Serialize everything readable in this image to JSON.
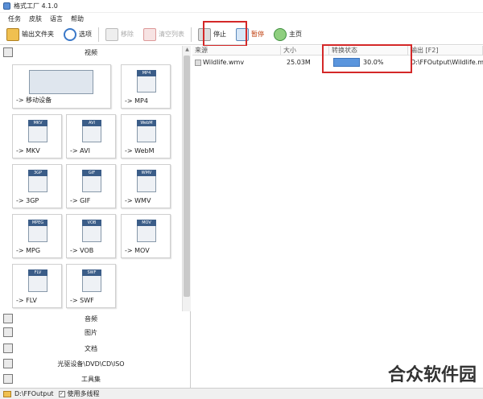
{
  "window": {
    "title": "格式工厂 4.1.0"
  },
  "menu": [
    "任务",
    "皮肤",
    "语言",
    "帮助"
  ],
  "toolbar": {
    "output_folder": "输出文件夹",
    "options": "选项",
    "remove": "移除",
    "clear_list": "清空列表",
    "stop": "停止",
    "pause": "暂停",
    "home": "主页"
  },
  "categories": {
    "video": "视频",
    "audio": "音频",
    "picture": "图片",
    "document": "文档",
    "optical": "光驱设备\\DVD\\CD\\ISO",
    "tools": "工具集"
  },
  "formats": [
    {
      "label": "-> 移动设备",
      "tag": ""
    },
    {
      "label": "-> MP4",
      "tag": "MP4"
    },
    {
      "label": "-> MKV",
      "tag": "MKV"
    },
    {
      "label": "-> AVI",
      "tag": "AVI"
    },
    {
      "label": "-> WebM",
      "tag": "WebM"
    },
    {
      "label": "-> 3GP",
      "tag": "3GP"
    },
    {
      "label": "-> GIF",
      "tag": "GIF"
    },
    {
      "label": "-> WMV",
      "tag": "WMV"
    },
    {
      "label": "-> MPG",
      "tag": "MPEG"
    },
    {
      "label": "-> VOB",
      "tag": "VOB"
    },
    {
      "label": "-> MOV",
      "tag": "MOV"
    },
    {
      "label": "-> FLV",
      "tag": "FLV"
    },
    {
      "label": "-> SWF",
      "tag": "SWF"
    }
  ],
  "columns": [
    "来源",
    "大小",
    "转换状态",
    "输出 [F2]"
  ],
  "files": [
    {
      "name": "Wildlife.wmv",
      "size": "25.03M",
      "progress": 0.3,
      "status": "30.0%",
      "output": "D:\\FFOutput\\Wildlife.mp4"
    }
  ],
  "statusbar": {
    "folder": "D:\\FFOutput",
    "multithread": "使用多线程"
  },
  "watermark": "合众软件园"
}
